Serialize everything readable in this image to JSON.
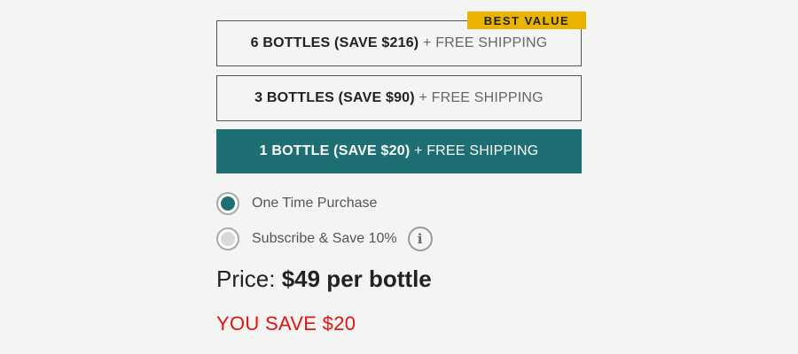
{
  "options": [
    {
      "bold": "6 BOTTLES (SAVE $216)",
      "extra": "+ FREE SHIPPING",
      "selected": false,
      "badge": "BEST VALUE"
    },
    {
      "bold": "3 BOTTLES (SAVE $90)",
      "extra": "+ FREE SHIPPING",
      "selected": false
    },
    {
      "bold": "1 BOTTLE (SAVE $20)",
      "extra": "+ FREE SHIPPING",
      "selected": true
    }
  ],
  "purchase_type": {
    "one_time": {
      "label": "One Time Purchase",
      "checked": true
    },
    "subscribe": {
      "label": "Subscribe & Save 10%",
      "checked": false,
      "info_icon": "i"
    }
  },
  "price": {
    "label": "Price:",
    "value": "$49 per bottle"
  },
  "savings": "YOU SAVE $20",
  "colors": {
    "selected_bg": "#1e6f73",
    "badge_bg": "#e9b300",
    "savings_red": "#e3130f"
  }
}
